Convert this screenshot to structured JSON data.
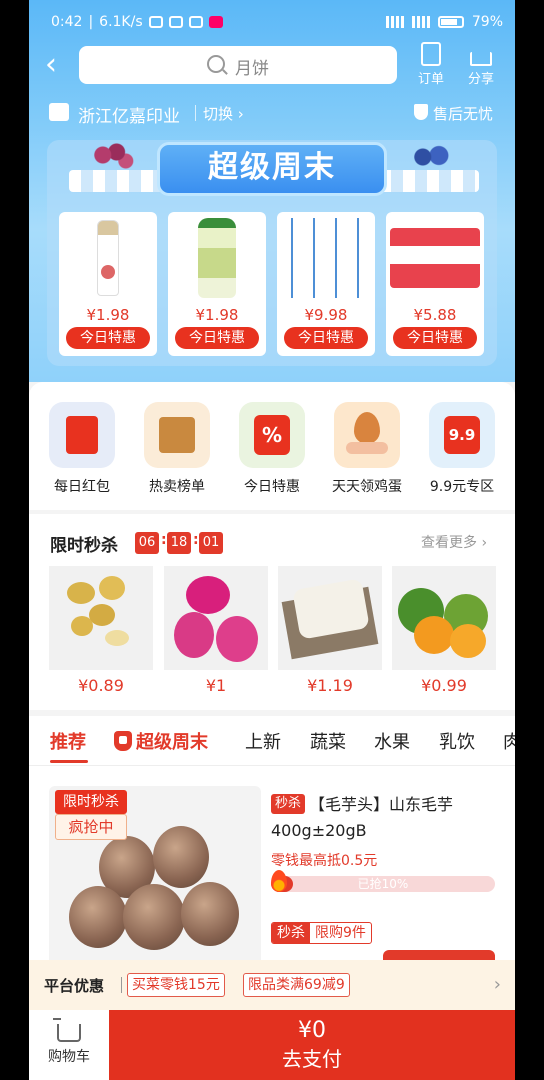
{
  "status_bar": {
    "time": "0:42",
    "net_speed": "6.1K/s",
    "battery": "79%"
  },
  "search": {
    "placeholder": "月饼"
  },
  "top_actions": {
    "orders": "订单",
    "share": "分享"
  },
  "store": {
    "name": "浙江亿嘉印业",
    "switch": "切换 ›",
    "after_sales": "售后无忧"
  },
  "super_weekend": {
    "title": "超级周末",
    "deals": [
      {
        "price": "¥1.98",
        "tag": "今日特惠"
      },
      {
        "price": "¥1.98",
        "tag": "今日特惠"
      },
      {
        "price": "¥9.98",
        "tag": "今日特惠"
      },
      {
        "price": "¥5.88",
        "tag": "今日特惠"
      }
    ]
  },
  "categories": [
    {
      "label": "每日红包",
      "icon": "red-envelope-icon"
    },
    {
      "label": "热卖榜单",
      "icon": "ranking-icon"
    },
    {
      "label": "今日特惠",
      "icon": "percent-icon"
    },
    {
      "label": "天天领鸡蛋",
      "icon": "egg-icon"
    },
    {
      "label": "9.9元专区",
      "icon": "shopping-bag-icon"
    }
  ],
  "flash_sale": {
    "title": "限时秒杀",
    "hours": "06",
    "minutes": "18",
    "seconds": "01",
    "more": "查看更多 ›",
    "items": [
      {
        "price": "¥0.89"
      },
      {
        "price": "¥1"
      },
      {
        "price": "¥1.19"
      },
      {
        "price": "¥0.99"
      }
    ]
  },
  "tabs": [
    "推荐",
    "超级周末",
    "上新",
    "蔬菜",
    "水果",
    "乳饮",
    "肉"
  ],
  "product": {
    "flag_top": "限时秒杀",
    "flag_bottom": "疯抢中",
    "sec_badge": "秒杀",
    "title": "【毛芋头】山东毛芋400g±20gB",
    "subsidy": "零钱最高抵0.5元",
    "progress_text": "已抢10%",
    "progress": 0.1,
    "tag_a": "秒杀",
    "tag_b": "限购9件"
  },
  "platform": {
    "label": "平台优惠",
    "coupons": [
      "买菜零钱15元",
      "限品类满69减9"
    ]
  },
  "bottom": {
    "cart": "购物车",
    "amount": "¥0",
    "pay": "去支付"
  },
  "colors": {
    "accent": "#e23a2a",
    "sky": "#5bb8f7"
  }
}
